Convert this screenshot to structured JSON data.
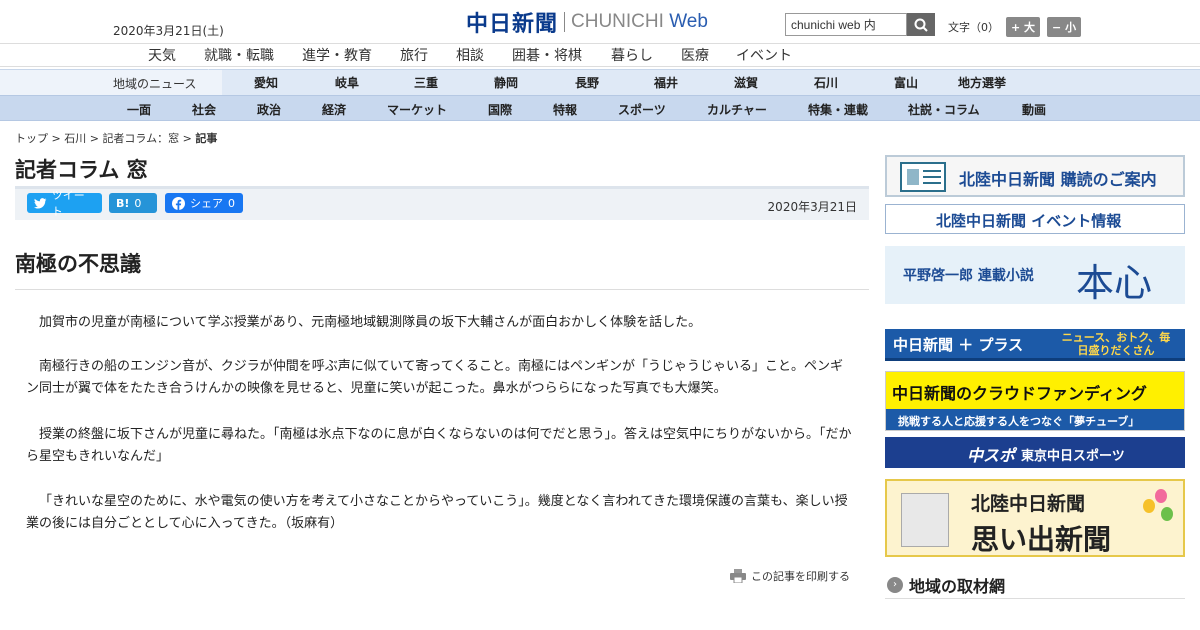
{
  "header": {
    "date": "2020年3月21日(土)",
    "logo_jp": "中日新聞",
    "logo_en_a": "CHUNICHI",
    "logo_en_b": "Web",
    "search_value": "chunichi web 内",
    "font_label": "文字（0）",
    "font_up": "+ 大",
    "font_down": "− 小"
  },
  "nav_primary": [
    "天気",
    "就職・転職",
    "進学・教育",
    "旅行",
    "相談",
    "囲碁・将棋",
    "暮らし",
    "医療",
    "イベント"
  ],
  "nav_region": {
    "label": "地域のニュース",
    "items": [
      "愛知",
      "岐阜",
      "三重",
      "静岡",
      "長野",
      "福井",
      "滋賀",
      "石川",
      "富山",
      "地方選挙"
    ]
  },
  "nav_category": [
    "一面",
    "社会",
    "政治",
    "経済",
    "マーケット",
    "国際",
    "特報",
    "スポーツ",
    "カルチャー",
    "特集・連載",
    "社説・コラム",
    "動画"
  ],
  "breadcrumb": [
    "トップ",
    "石川",
    "記者コラム：窓",
    "記事"
  ],
  "article": {
    "column_title": "記者コラム 窓",
    "tweet_label": "ツイート",
    "hatena_label": "B!",
    "hatena_count": "0",
    "share_label": "シェア",
    "share_count": "0",
    "date": "2020年3月21日",
    "headline": "南極の不思議",
    "paragraphs": [
      "加賀市の児童が南極について学ぶ授業があり、元南極地域観測隊員の坂下大輔さんが面白おかしく体験を話した。",
      "南極行きの船のエンジン音が、クジラが仲間を呼ぶ声に似ていて寄ってくること。南極にはペンギンが「うじゃうじゃいる」こと。ペンギン同士が翼で体をたたき合うけんかの映像を見せると、児童に笑いが起こった。鼻水がつららになった写真でも大爆笑。",
      "授業の終盤に坂下さんが児童に尋ねた。「南極は氷点下なのに息が白くならないのは何でだと思う」。答えは空気中にちりがないから。「だから星空もきれいなんだ」",
      "「きれいな星空のために、水や電気の使い方を考えて小さなことからやっていこう」。幾度となく言われてきた環境保護の言葉も、楽しい授業の後には自分ごととして心に入ってきた。（坂麻有）"
    ],
    "print_label": "この記事を印刷する"
  },
  "sidebar": {
    "subscribe": "北陸中日新聞 購読のご案内",
    "event": "北陸中日新聞 イベント情報",
    "novel_a": "平野啓一郎 連載小説",
    "novel_b": "本心",
    "plus_a": "中日新聞 ＋ プラス",
    "plus_b": "ニュース、おトク、毎日盛りだくさん",
    "crowd_a": "中日新聞のクラウドファンディング",
    "crowd_b": "挑戦する人と応援する人をつなぐ「夢チューブ」",
    "sports_a": "中スポ",
    "sports_b": "東京中日スポーツ",
    "memory_a": "北陸中日新聞",
    "memory_b": "思い出新聞",
    "regional": "地域の取材網"
  }
}
